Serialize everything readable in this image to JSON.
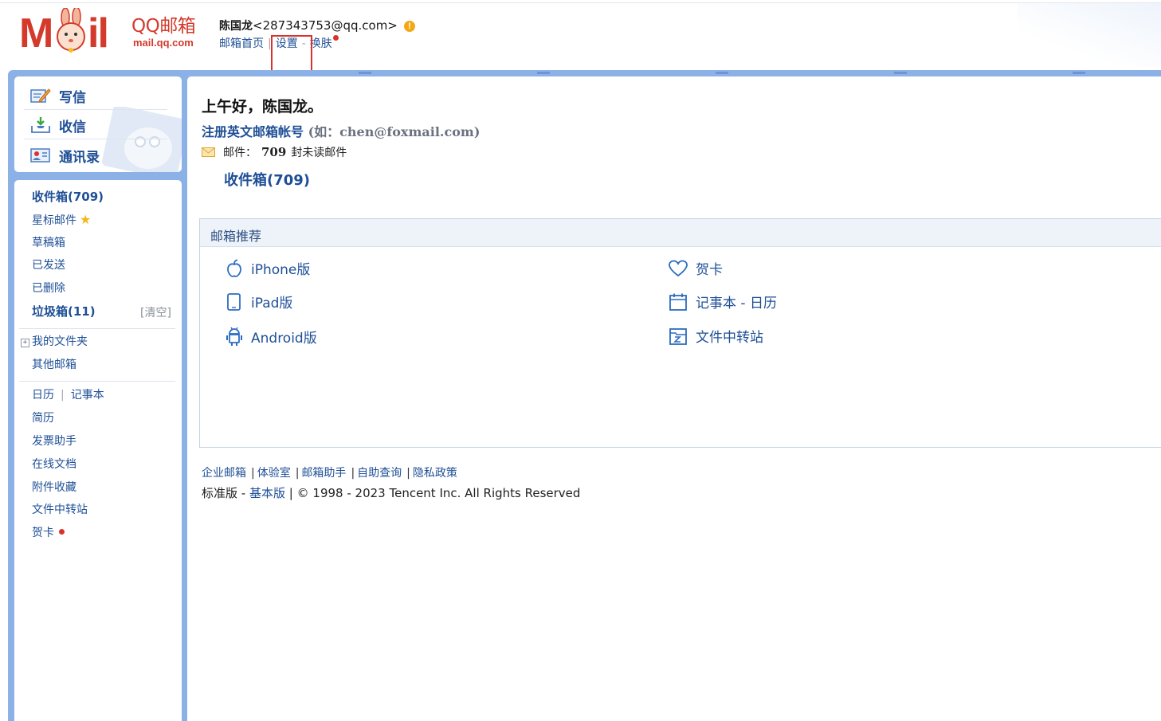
{
  "header": {
    "logo": {
      "qq_label": "QQ邮箱",
      "domain": "mail.qq.com",
      "mail_m": "M",
      "mail_il": "il"
    },
    "user_name": "陈国龙",
    "user_email": "<287343753@qq.com>",
    "warning_glyph": "!",
    "nav": {
      "home": "邮箱首页",
      "sep": "|",
      "settings": "设置",
      "dash": "-",
      "skin": "换肤"
    }
  },
  "sidebar": {
    "actions": {
      "compose": "写信",
      "receive": "收信",
      "contacts": "通讯录"
    },
    "folders": {
      "inbox": "收件箱(709)",
      "starred": "星标邮件",
      "star_glyph": "★",
      "drafts": "草稿箱",
      "sent": "已发送",
      "deleted": "已删除",
      "spam": "垃圾箱(11)",
      "spam_clear": "[清空]"
    },
    "my_folders": "我的文件夹",
    "plus_glyph": "+",
    "other_mailbox": "其他邮箱",
    "tools": {
      "calendar": "日历",
      "sep": "|",
      "notebook": "记事本",
      "resume": "简历",
      "invoice": "发票助手",
      "docs": "在线文档",
      "attachments": "附件收藏",
      "transfer": "文件中转站",
      "card": "贺卡"
    }
  },
  "main": {
    "greeting": "上午好，陈国龙。",
    "register_label": "注册英文邮箱帐号",
    "register_hint": "(如：chen@foxmail.com)",
    "mail_prefix": "邮件：",
    "mail_count": "709",
    "mail_suffix": "封未读邮件",
    "inbox_link": "收件箱(709)",
    "recommend": {
      "title": "邮箱推荐",
      "items": [
        "iPhone版",
        "iPad版",
        "Android版",
        "贺卡",
        "记事本 - 日历",
        "文件中转站"
      ]
    },
    "footer": {
      "links": [
        "企业邮箱",
        "体验室",
        "邮箱助手",
        "自助查询",
        "隐私政策"
      ],
      "sep": "|",
      "std": "标准版",
      "dash": "-",
      "basic": "基本版",
      "pipe": "|",
      "copyright": "© 1998 - 2023 Tencent Inc. All Rights Reserved"
    }
  },
  "colors": {
    "accent": "#1e4f96",
    "brand": "#d43a2b",
    "frame": "#8cb1e6",
    "alert": "#d9322b"
  }
}
